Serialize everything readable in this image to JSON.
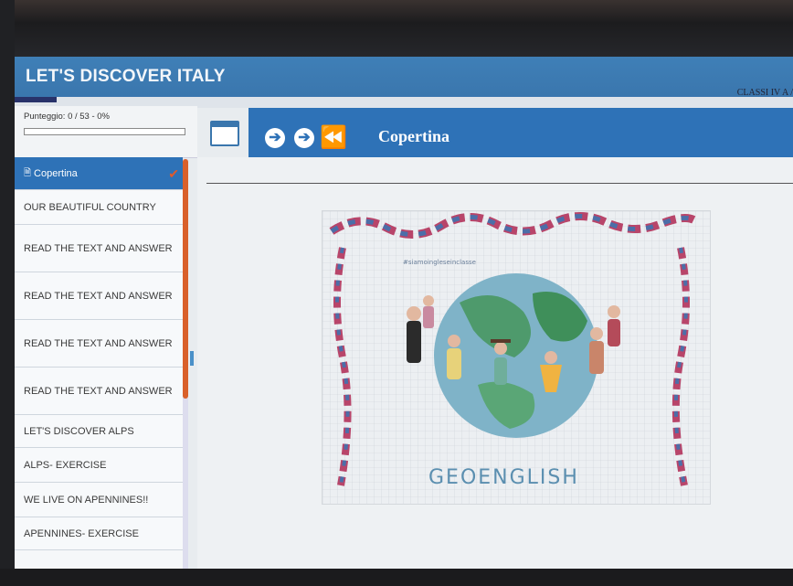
{
  "app": {
    "title": "LET'S DISCOVER ITALY",
    "class_label": "CLASSI IV A /"
  },
  "score": {
    "label": "Punteggio: 0 / 53 - 0%",
    "progress": 0
  },
  "nav": {
    "page_title": "Copertina",
    "prev_icon": "arrow-left-circle-icon",
    "next_icon": "arrow-right-circle-icon",
    "first_icon": "rewind-icon",
    "toggle_icon": "window-icon"
  },
  "sidebar": {
    "items": [
      {
        "label": "Copertina",
        "icon": "document-icon",
        "active": true,
        "checked": true
      },
      {
        "label": "OUR BEAUTIFUL COUNTRY"
      },
      {
        "label": "READ THE TEXT AND ANSWER"
      },
      {
        "label": "READ THE TEXT AND ANSWER"
      },
      {
        "label": "READ THE TEXT AND ANSWER"
      },
      {
        "label": "READ THE TEXT AND ANSWER"
      },
      {
        "label": "LET'S DISCOVER ALPS"
      },
      {
        "label": "ALPS- EXERCISE"
      },
      {
        "label": "WE LIVE ON APENNINES!!"
      },
      {
        "label": "APENNINES- EXERCISE"
      }
    ]
  },
  "cover": {
    "hashtag": "#siamoingleseinclasse",
    "title": "GEOENGLISH"
  },
  "colors": {
    "accent": "#2e72b7",
    "check": "#e05a2c"
  }
}
